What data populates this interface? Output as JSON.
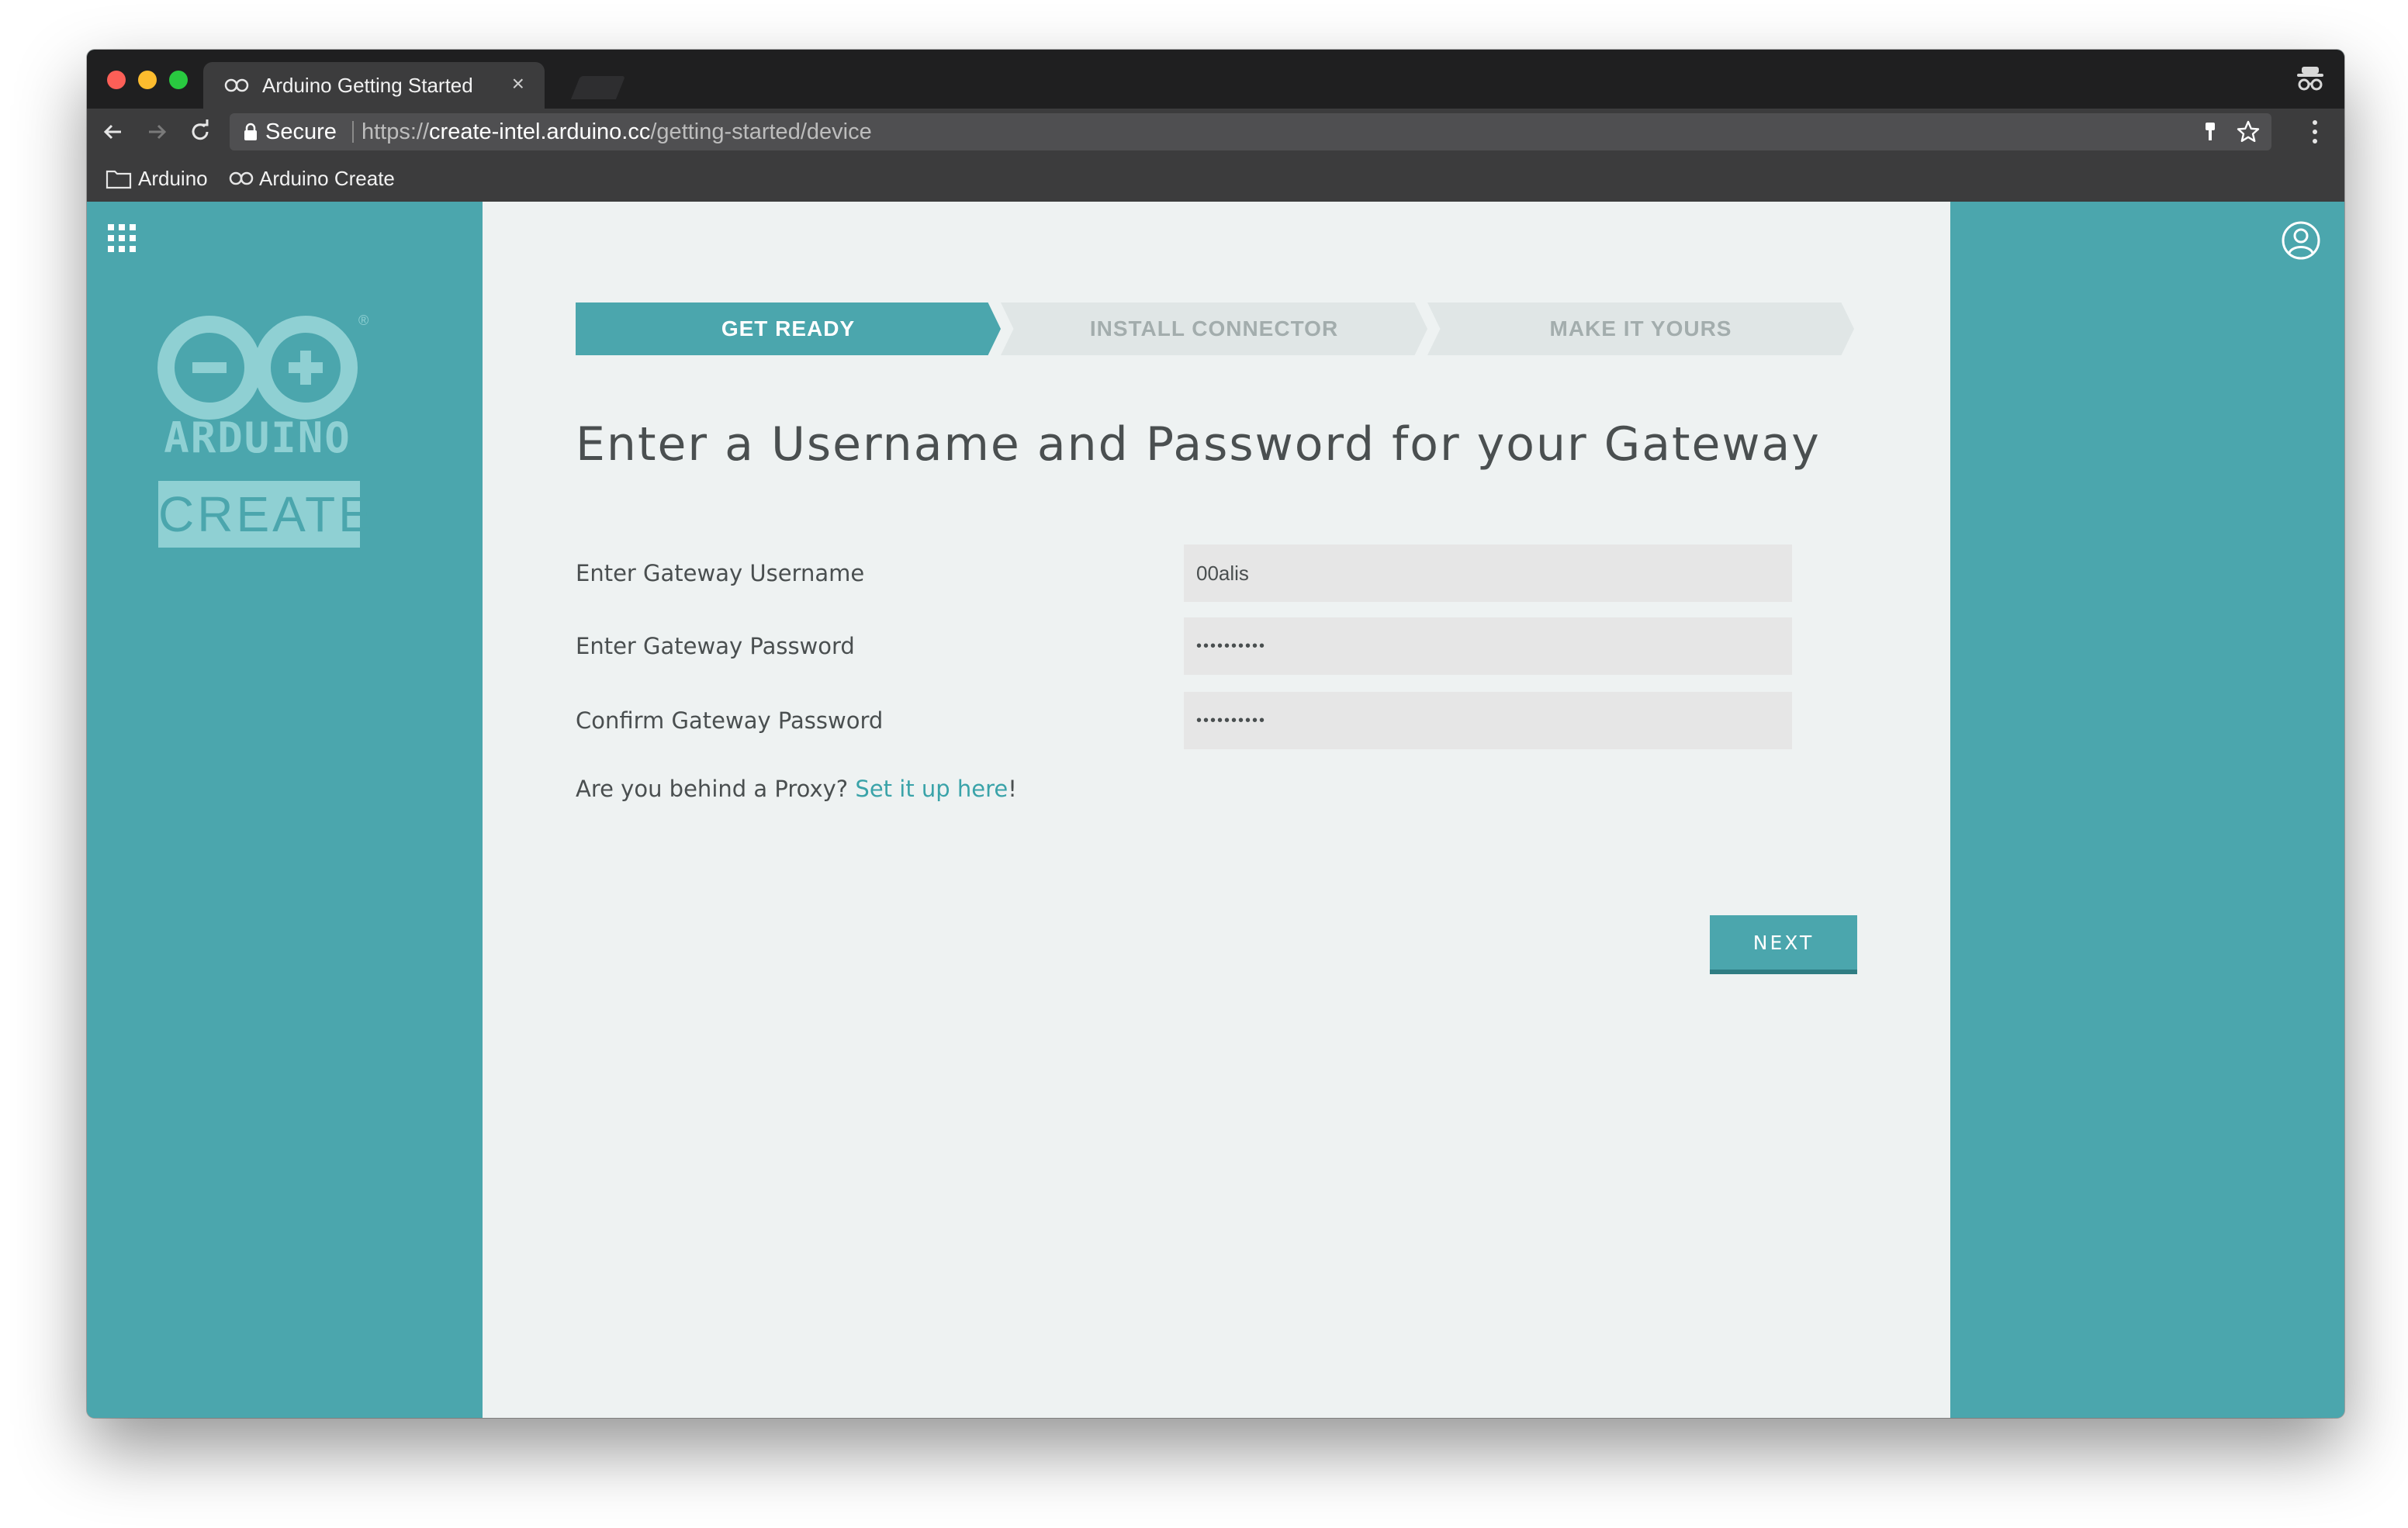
{
  "browser": {
    "tab": {
      "title": "Arduino Getting Started",
      "close_glyph": "×",
      "icon": "arduino-infinity-icon"
    },
    "address_bar": {
      "secure_label": "Secure",
      "url_prefix": "https://",
      "url_host": "create-intel.arduino.cc",
      "url_path": "/getting-started/device"
    },
    "bookmarks": [
      {
        "label": "Arduino",
        "icon": "folder-icon"
      },
      {
        "label": "Arduino Create",
        "icon": "arduino-infinity-icon"
      }
    ]
  },
  "sidebar": {
    "logo_text": "ARDUINO",
    "product": "CREATE",
    "registered_mark": "®"
  },
  "steps": [
    {
      "label": "GET READY",
      "state": "active"
    },
    {
      "label": "INSTALL CONNECTOR",
      "state": "inactive"
    },
    {
      "label": "MAKE IT YOURS",
      "state": "inactive"
    }
  ],
  "form": {
    "heading": "Enter a Username and Password for your Gateway",
    "fields": [
      {
        "label": "Enter Gateway Username",
        "value": "00alis",
        "type": "text"
      },
      {
        "label": "Enter Gateway Password",
        "value": "••••••••••",
        "type": "password"
      },
      {
        "label": "Confirm Gateway Password",
        "value": "••••••••••",
        "type": "password"
      }
    ],
    "proxy": {
      "question": "Are you behind a Proxy? ",
      "link": "Set it up here",
      "suffix": "!"
    },
    "next_label": "NEXT"
  },
  "colors": {
    "teal": "#4ba6ad",
    "link": "#3aa3a9",
    "content_bg": "#eef2f2",
    "inactive_step_bg": "#e0e6e6"
  }
}
